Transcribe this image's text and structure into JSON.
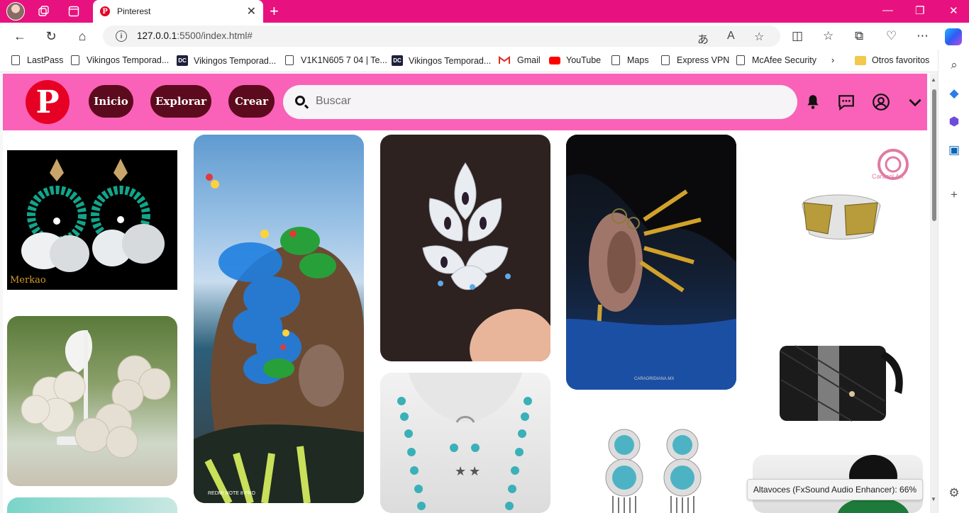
{
  "browser": {
    "tab": {
      "title": "Pinterest",
      "favicon": "pinterest-favicon"
    },
    "address": {
      "url_host": "127.0.0.1",
      "url_rest": ":5500/index.html#"
    },
    "bookmarks": [
      {
        "label": "LastPass",
        "icon": "page-icon"
      },
      {
        "label": "Vikingos Temporad...",
        "icon": "page-icon"
      },
      {
        "label": "Vikingos Temporad...",
        "icon": "dc-icon"
      },
      {
        "label": "V1K1N605 7 04 | Te...",
        "icon": "page-icon"
      },
      {
        "label": "Vikingos Temporad...",
        "icon": "dc-icon"
      },
      {
        "label": "Gmail",
        "icon": "gmail-icon"
      },
      {
        "label": "YouTube",
        "icon": "youtube-icon"
      },
      {
        "label": "Maps",
        "icon": "page-icon"
      },
      {
        "label": "Express VPN",
        "icon": "page-icon"
      },
      {
        "label": "McAfee Security",
        "icon": "page-icon"
      }
    ],
    "other_favorites": "Otros favoritos",
    "tooltip": "Altavoces (FxSound Audio Enhancer): 66%"
  },
  "pinterest": {
    "logo_letter": "P",
    "nav": {
      "home": "Inicio",
      "explore": "Explorar",
      "create": "Crear"
    },
    "search_placeholder": "Buscar",
    "colors": {
      "header": "#f962b8",
      "pill": "#5c0a1d",
      "logo": "#e60023",
      "chrome": "#e7127f"
    }
  },
  "pins": [
    {
      "name": "pin-shell-hoop-earrings",
      "caption": "Merkao"
    },
    {
      "name": "pin-shell-flower-earrings",
      "caption": ""
    },
    {
      "name": "pin-blue-flower-hair-clip",
      "caption": "REDMI NOTE 8 PRO"
    },
    {
      "name": "pin-white-flower-brooch",
      "caption": ""
    },
    {
      "name": "pin-turquoise-pearl-necklace",
      "caption": ""
    },
    {
      "name": "pin-feather-ear-cuff",
      "caption": "CARAORIDIANA.MX"
    },
    {
      "name": "pin-silver-turquoise-earrings",
      "caption": ""
    },
    {
      "name": "pin-gold-silver-ring",
      "caption": "Caracol Art"
    },
    {
      "name": "pin-black-leather-clutch",
      "caption": ""
    },
    {
      "name": "pin-model-portrait",
      "caption": ""
    }
  ]
}
